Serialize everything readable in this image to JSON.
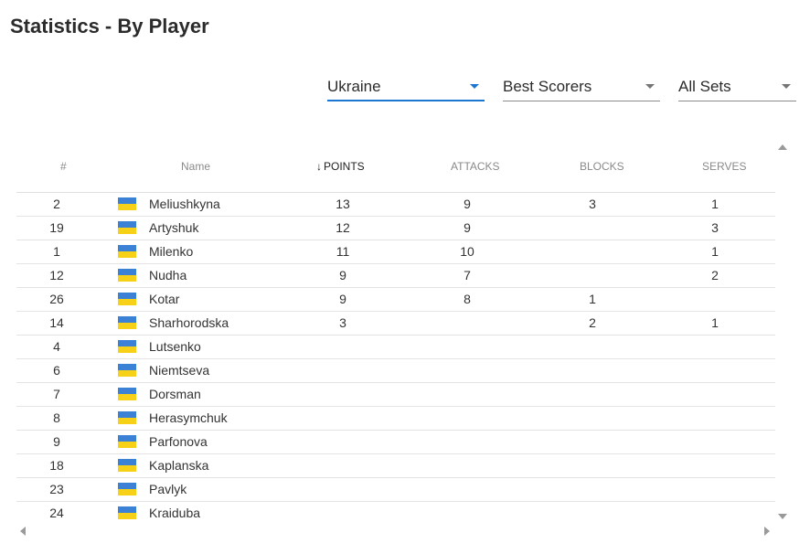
{
  "page": {
    "title": "Statistics - By Player"
  },
  "filters": {
    "team": "Ukraine",
    "category": "Best Scorers",
    "sets": "All Sets"
  },
  "colors": {
    "accent": "#1976d2",
    "flag_blue": "#3b82d6",
    "flag_yellow": "#f7d117"
  },
  "table": {
    "headers": {
      "num": "#",
      "name": "Name",
      "points": "POINTS",
      "attacks": "ATTACKS",
      "blocks": "BLOCKS",
      "serves": "SERVES"
    },
    "sort_arrow": "↓",
    "rows": [
      {
        "num": "2",
        "name": "Meliushkyna",
        "points": "13",
        "attacks": "9",
        "blocks": "3",
        "serves": "1"
      },
      {
        "num": "19",
        "name": "Artyshuk",
        "points": "12",
        "attacks": "9",
        "blocks": "",
        "serves": "3"
      },
      {
        "num": "1",
        "name": "Milenko",
        "points": "11",
        "attacks": "10",
        "blocks": "",
        "serves": "1"
      },
      {
        "num": "12",
        "name": "Nudha",
        "points": "9",
        "attacks": "7",
        "blocks": "",
        "serves": "2"
      },
      {
        "num": "26",
        "name": "Kotar",
        "points": "9",
        "attacks": "8",
        "blocks": "1",
        "serves": ""
      },
      {
        "num": "14",
        "name": "Sharhorodska",
        "points": "3",
        "attacks": "",
        "blocks": "2",
        "serves": "1"
      },
      {
        "num": "4",
        "name": "Lutsenko",
        "points": "",
        "attacks": "",
        "blocks": "",
        "serves": ""
      },
      {
        "num": "6",
        "name": "Niemtseva",
        "points": "",
        "attacks": "",
        "blocks": "",
        "serves": ""
      },
      {
        "num": "7",
        "name": "Dorsman",
        "points": "",
        "attacks": "",
        "blocks": "",
        "serves": ""
      },
      {
        "num": "8",
        "name": "Herasymchuk",
        "points": "",
        "attacks": "",
        "blocks": "",
        "serves": ""
      },
      {
        "num": "9",
        "name": "Parfonova",
        "points": "",
        "attacks": "",
        "blocks": "",
        "serves": ""
      },
      {
        "num": "18",
        "name": "Kaplanska",
        "points": "",
        "attacks": "",
        "blocks": "",
        "serves": ""
      },
      {
        "num": "23",
        "name": "Pavlyk",
        "points": "",
        "attacks": "",
        "blocks": "",
        "serves": ""
      },
      {
        "num": "24",
        "name": "Kraiduba",
        "points": "",
        "attacks": "",
        "blocks": "",
        "serves": ""
      }
    ]
  }
}
